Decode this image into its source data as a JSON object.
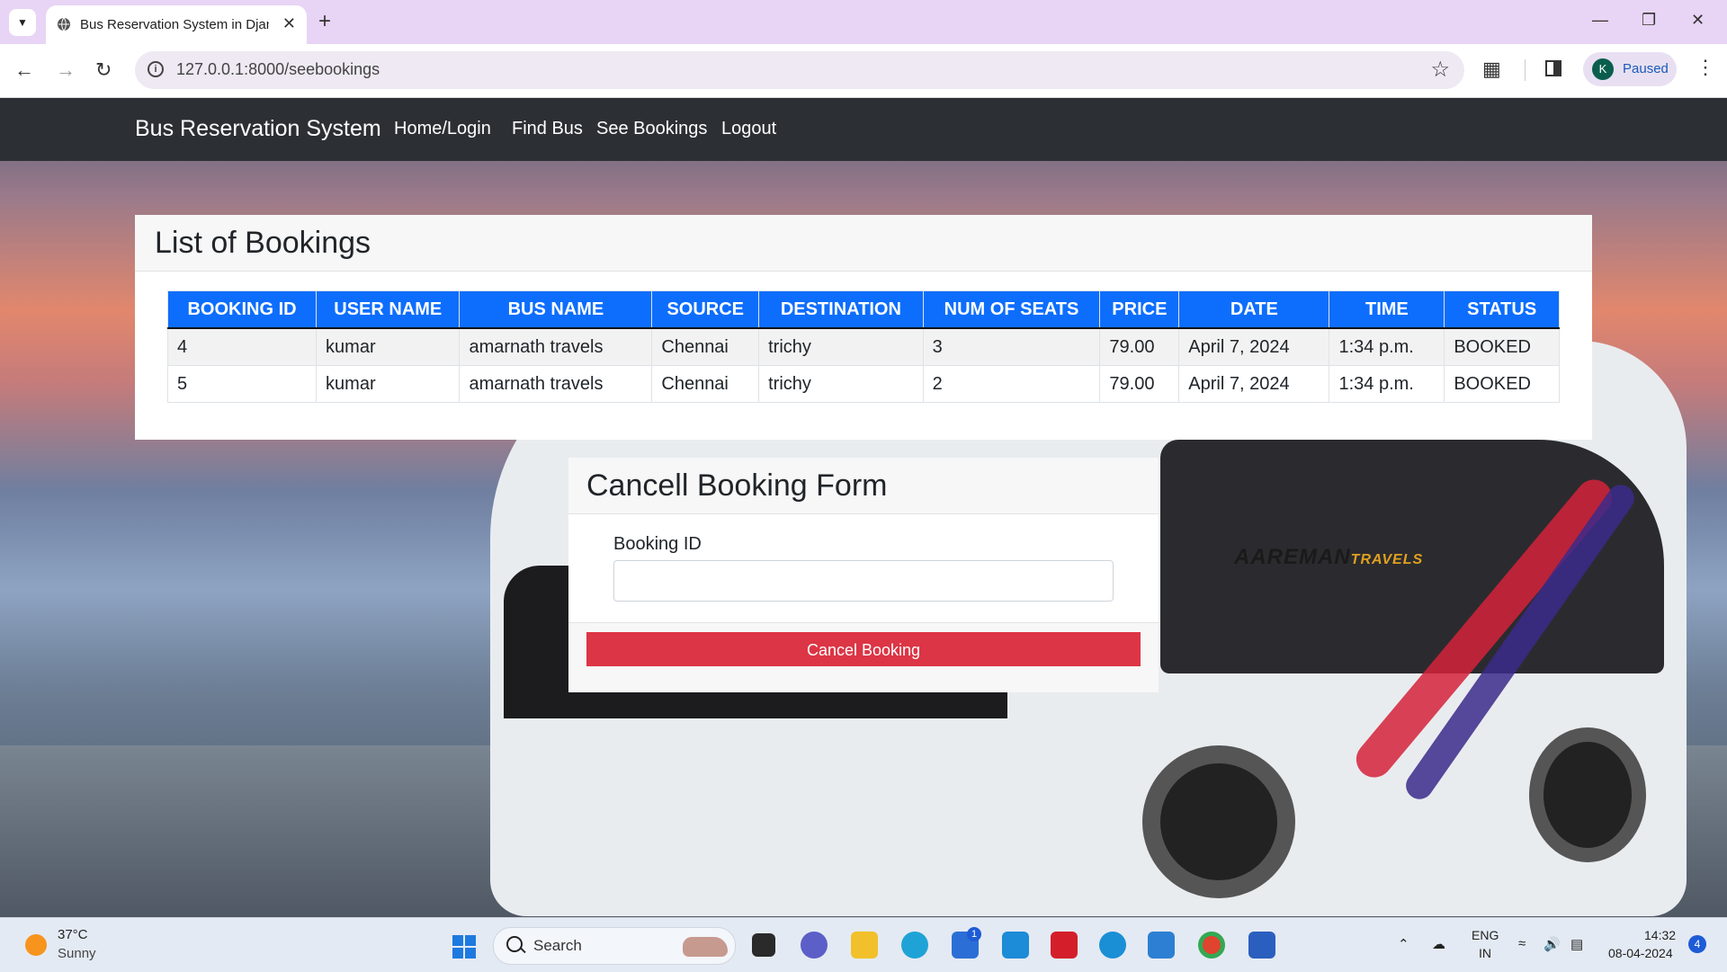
{
  "browser": {
    "tab_title": "Bus Reservation System in Djan",
    "url": "127.0.0.1:8000/seebookings",
    "profile_initial": "K",
    "profile_status": "Paused"
  },
  "navbar": {
    "brand": "Bus Reservation System",
    "links": [
      "Home/Login",
      "Find Bus",
      "See Bookings",
      "Logout"
    ]
  },
  "bookings": {
    "title": "List of Bookings",
    "columns": [
      "BOOKING ID",
      "USER NAME",
      "BUS NAME",
      "SOURCE",
      "DESTINATION",
      "NUM OF SEATS",
      "PRICE",
      "DATE",
      "TIME",
      "STATUS"
    ],
    "rows": [
      [
        "4",
        "kumar",
        "amarnath travels",
        "Chennai",
        "trichy",
        "3",
        "79.00",
        "April 7, 2024",
        "1:34 p.m.",
        "BOOKED"
      ],
      [
        "5",
        "kumar",
        "amarnath travels",
        "Chennai",
        "trichy",
        "2",
        "79.00",
        "April 7, 2024",
        "1:34 p.m.",
        "BOOKED"
      ]
    ]
  },
  "cancel_form": {
    "title": "Cancell Booking Form",
    "field_label": "Booking ID",
    "field_value": "",
    "button_label": "Cancel Booking"
  },
  "background": {
    "bus_logo": "AAREMAN",
    "bus_logo_suffix": "TRAVELS"
  },
  "taskbar": {
    "temperature": "37°C",
    "condition": "Sunny",
    "search_placeholder": "Search",
    "store_badge": "1",
    "lang_line1": "ENG",
    "lang_line2": "IN",
    "time": "14:32",
    "date": "08-04-2024",
    "notification_count": "4"
  },
  "colors": {
    "primary": "#0d6efd",
    "danger": "#dc3545",
    "navbar": "#2c3034"
  }
}
